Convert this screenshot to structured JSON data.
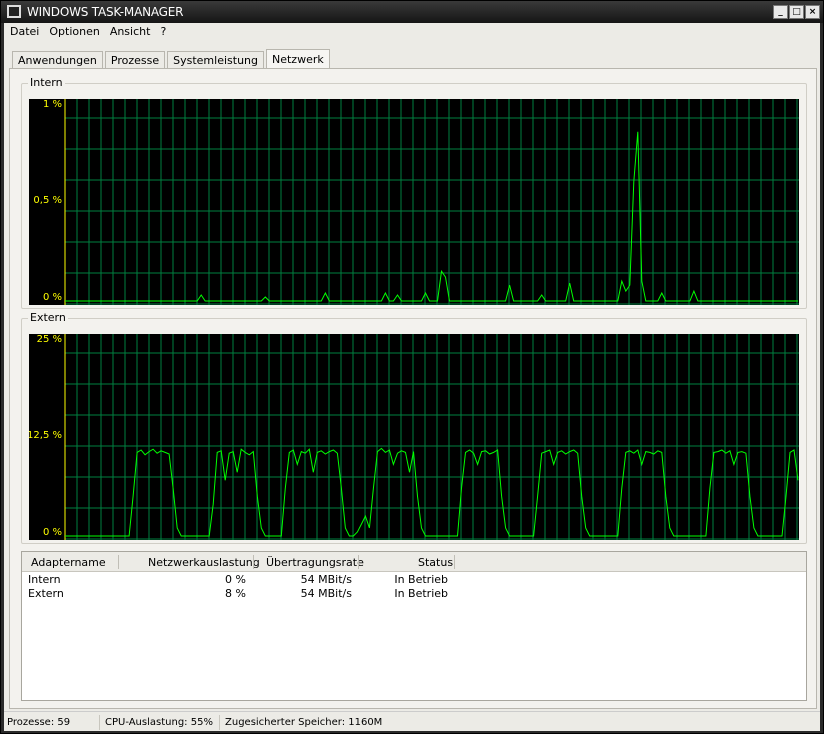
{
  "window": {
    "title": "WINDOWS TASK-MANAGER",
    "controls": [
      "_",
      "□",
      "×"
    ]
  },
  "menu": [
    "Datei",
    "Optionen",
    "Ansicht",
    "?"
  ],
  "tabs": [
    {
      "label": "Anwendungen"
    },
    {
      "label": "Prozesse"
    },
    {
      "label": "Systemleistung"
    },
    {
      "label": "Netzwerk",
      "active": true
    }
  ],
  "colors": {
    "grid": "#008040",
    "line": "#00ff00",
    "axis": "#ffff00",
    "label": "#ffff00",
    "background": "#000000"
  },
  "chart_data": [
    {
      "type": "line",
      "title": "Intern",
      "ylim": [
        0,
        1
      ],
      "yticks": [
        "1 %",
        "0,5 %",
        "0 %"
      ],
      "grid": true,
      "values": [
        0,
        0,
        0,
        0,
        0,
        0,
        0,
        0,
        0,
        0,
        0,
        0,
        0,
        0,
        0,
        0,
        0,
        0,
        0,
        0,
        0,
        0,
        0,
        0,
        0,
        0,
        0,
        0,
        0,
        0,
        0,
        0,
        0,
        0,
        0.03,
        0,
        0,
        0,
        0,
        0,
        0,
        0,
        0,
        0,
        0,
        0,
        0,
        0,
        0,
        0,
        0.02,
        0,
        0,
        0,
        0,
        0,
        0,
        0,
        0,
        0,
        0,
        0,
        0,
        0,
        0,
        0.04,
        0,
        0,
        0,
        0,
        0,
        0,
        0,
        0,
        0,
        0,
        0,
        0,
        0,
        0,
        0.04,
        0,
        0,
        0.03,
        0,
        0,
        0,
        0,
        0,
        0,
        0.04,
        0,
        0,
        0,
        0.15,
        0.12,
        0,
        0,
        0,
        0,
        0,
        0,
        0,
        0,
        0,
        0,
        0,
        0,
        0,
        0,
        0,
        0.08,
        0,
        0,
        0,
        0,
        0,
        0,
        0,
        0.03,
        0,
        0,
        0,
        0,
        0,
        0,
        0.09,
        0,
        0,
        0,
        0,
        0,
        0,
        0,
        0,
        0,
        0,
        0,
        0,
        0.1,
        0.05,
        0.08,
        0.6,
        0.85,
        0.1,
        0,
        0,
        0,
        0,
        0.04,
        0,
        0,
        0,
        0,
        0,
        0,
        0,
        0.05,
        0,
        0,
        0,
        0,
        0,
        0,
        0,
        0,
        0,
        0,
        0,
        0,
        0,
        0,
        0,
        0,
        0,
        0,
        0,
        0,
        0,
        0,
        0,
        0,
        0,
        0
      ]
    },
    {
      "type": "line",
      "title": "Extern",
      "ylim": [
        0,
        25
      ],
      "yticks": [
        "25 %",
        "12,5 %",
        "0 %"
      ],
      "grid": true,
      "values": [
        0,
        0,
        0,
        0,
        0,
        0,
        0,
        0,
        0,
        0,
        0,
        0,
        0,
        0,
        0,
        0,
        0,
        5,
        10.5,
        10.8,
        10.2,
        10.6,
        10.9,
        10.4,
        10.7,
        10.5,
        10.3,
        6,
        1,
        0,
        0,
        0,
        0,
        0,
        0,
        0,
        0,
        4,
        10.5,
        10.7,
        7,
        10.4,
        10.6,
        8,
        10.9,
        10.5,
        10.2,
        10.6,
        5,
        1,
        0,
        0,
        0,
        0,
        0,
        6,
        10.5,
        10.8,
        9,
        10.6,
        10.4,
        10.9,
        8,
        10.5,
        10.7,
        10.3,
        10.6,
        10.8,
        10.4,
        6,
        1,
        0,
        0,
        0.5,
        1.5,
        2.5,
        1,
        6,
        10.6,
        11,
        10.5,
        10.8,
        9,
        10.4,
        10.7,
        10.5,
        8,
        10.6,
        5,
        1,
        0,
        0,
        0,
        0,
        0,
        0,
        0,
        0,
        0,
        6,
        10.5,
        10.8,
        10.4,
        9,
        10.6,
        10.7,
        10.3,
        10.5,
        10.8,
        5,
        1,
        0,
        0,
        0,
        0,
        0,
        0,
        0,
        5,
        10.4,
        10.6,
        10.8,
        9,
        10.5,
        10.7,
        10.3,
        10.6,
        10.8,
        10.4,
        5,
        1,
        0,
        0,
        0,
        0,
        0,
        0,
        0,
        0,
        6,
        10.5,
        10.7,
        10.4,
        10.8,
        9,
        10.6,
        10.5,
        10.3,
        10.7,
        10.5,
        5,
        1,
        0,
        0,
        0,
        0,
        0,
        0,
        0,
        0,
        0,
        6,
        10.5,
        10.6,
        10.8,
        10.4,
        10.7,
        9,
        10.5,
        10.6,
        10.4,
        5,
        1,
        0,
        0,
        0,
        0,
        0,
        0,
        0,
        5,
        10.5,
        10.8,
        7
      ]
    }
  ],
  "adapters": {
    "columns": [
      "Adaptername",
      "Netzwerkauslastung",
      "Übertragungsrate",
      "Status"
    ],
    "rows": [
      [
        "Intern",
        "0 %",
        "54 MBit/s",
        "In Betrieb"
      ],
      [
        "Extern",
        "8 %",
        "54 MBit/s",
        "In Betrieb"
      ]
    ]
  },
  "status": {
    "processes": "Prozesse: 59",
    "cpu": "CPU-Auslastung: 55%",
    "memory": "Zugesicherter Speicher: 1160M"
  }
}
